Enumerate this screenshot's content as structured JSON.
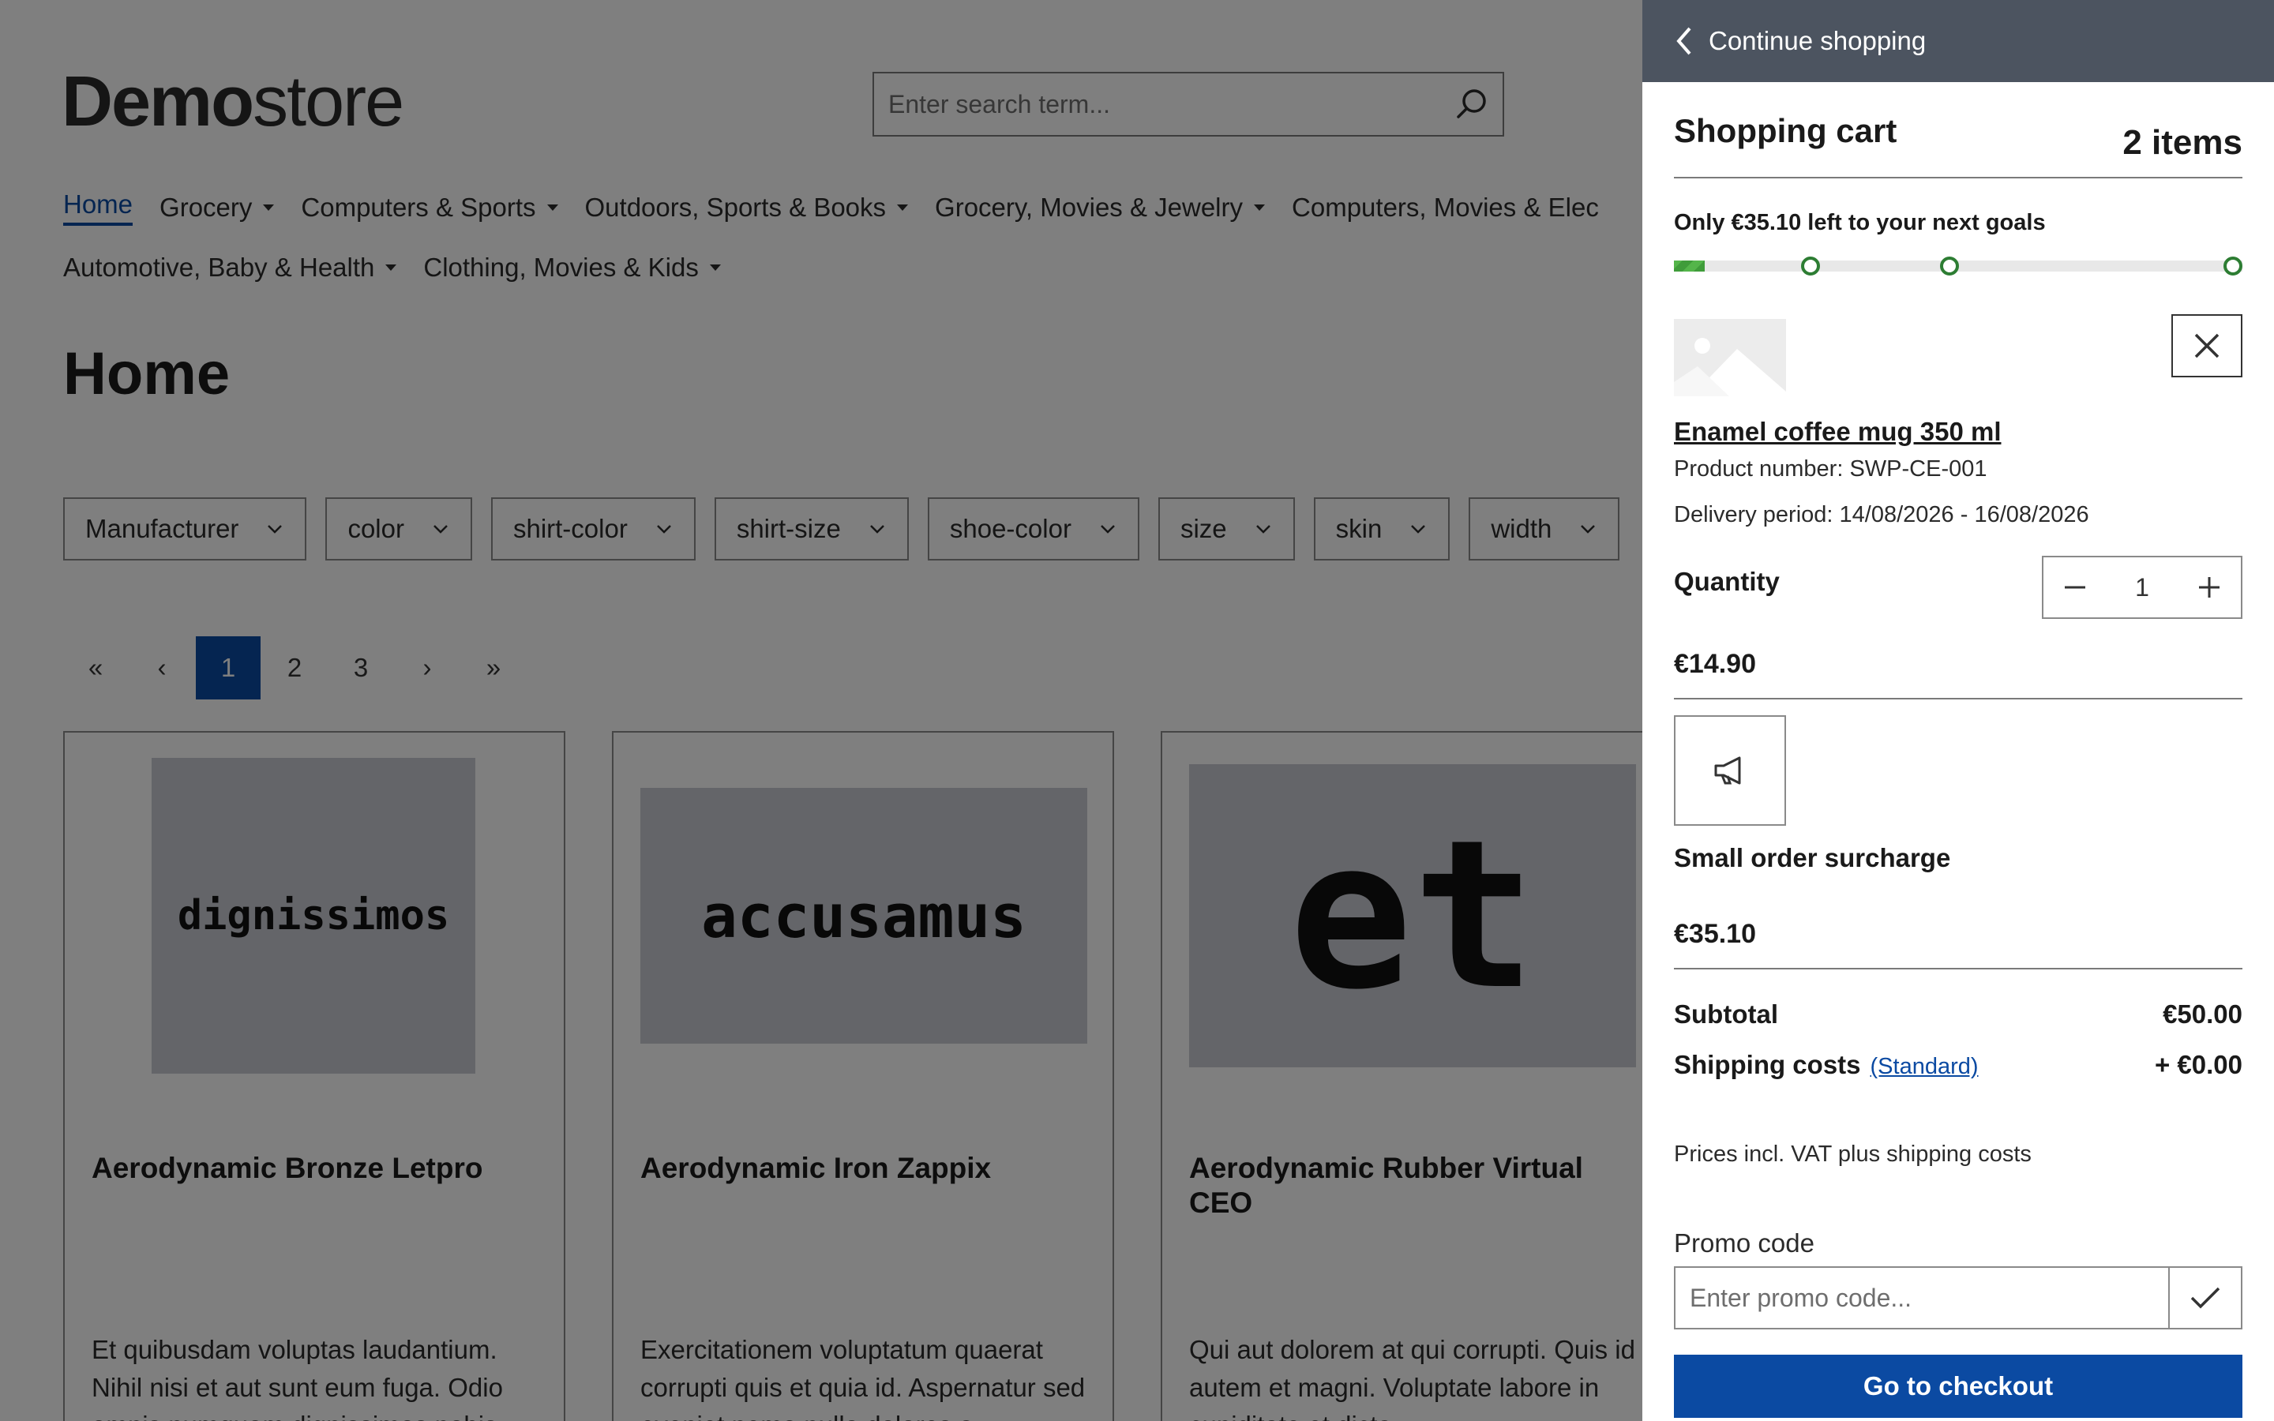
{
  "logo": {
    "bold": "Demo",
    "light": "store"
  },
  "search": {
    "placeholder": "Enter search term..."
  },
  "nav": {
    "row1": [
      "Home",
      "Grocery",
      "Computers & Sports",
      "Outdoors, Sports & Books",
      "Grocery, Movies & Jewelry",
      "Computers, Movies & Elec"
    ],
    "row2": [
      "Automotive, Baby & Health",
      "Clothing, Movies & Kids"
    ]
  },
  "page": {
    "title": "Home"
  },
  "filters": [
    "Manufacturer",
    "color",
    "shirt-color",
    "shirt-size",
    "shoe-color",
    "size",
    "skin",
    "width"
  ],
  "pagination": {
    "first": "«",
    "prev": "‹",
    "pages": [
      "1",
      "2",
      "3"
    ],
    "next": "›",
    "last": "»"
  },
  "products": [
    {
      "image_text": "dignissimos",
      "name": "Aerodynamic Bronze Letpro",
      "desc": "Et quibusdam voluptas laudantium. Nihil nisi et aut sunt eum fuga. Odio omnis numquam dignissimos nobis"
    },
    {
      "image_text": "accusamus",
      "name": "Aerodynamic Iron Zappix",
      "desc": "Exercitationem voluptatum quaerat corrupti quis et quia id. Aspernatur sed eveniet nemo nulla dolores a"
    },
    {
      "image_text": "et",
      "name": "Aerodynamic Rubber Virtual CEO",
      "desc": "Qui aut dolorem at qui corrupti. Quis id autem et magni. Voluptate labore in cupiditate et dicta"
    }
  ],
  "cart": {
    "back_label": "Continue shopping",
    "title": "Shopping cart",
    "count": "2 items",
    "goal_text": "Only €35.10 left to your next goals",
    "goal_progress": 0.054,
    "goal_markers": [
      0.24,
      0.485,
      1.0
    ],
    "item": {
      "name": "Enamel coffee mug 350 ml",
      "number": "Product number: SWP-CE-001",
      "delivery": "Delivery period: 14/08/2026 - 16/08/2026",
      "qty_label": "Quantity",
      "qty": "1",
      "price": "€14.90"
    },
    "surcharge": {
      "name": "Small order surcharge",
      "price": "€35.10"
    },
    "subtotal": {
      "label": "Subtotal",
      "value": "€50.00"
    },
    "shipping": {
      "label": "Shipping costs",
      "method": "(Standard)",
      "value": "+ €0.00"
    },
    "vat_note": "Prices incl. VAT plus shipping costs",
    "promo": {
      "label": "Promo code",
      "placeholder": "Enter promo code..."
    },
    "checkout_label": "Go to checkout"
  },
  "colors": {
    "accent": "#0b4aa2",
    "progress": "#3f9c3a",
    "header": "#4c5460"
  }
}
